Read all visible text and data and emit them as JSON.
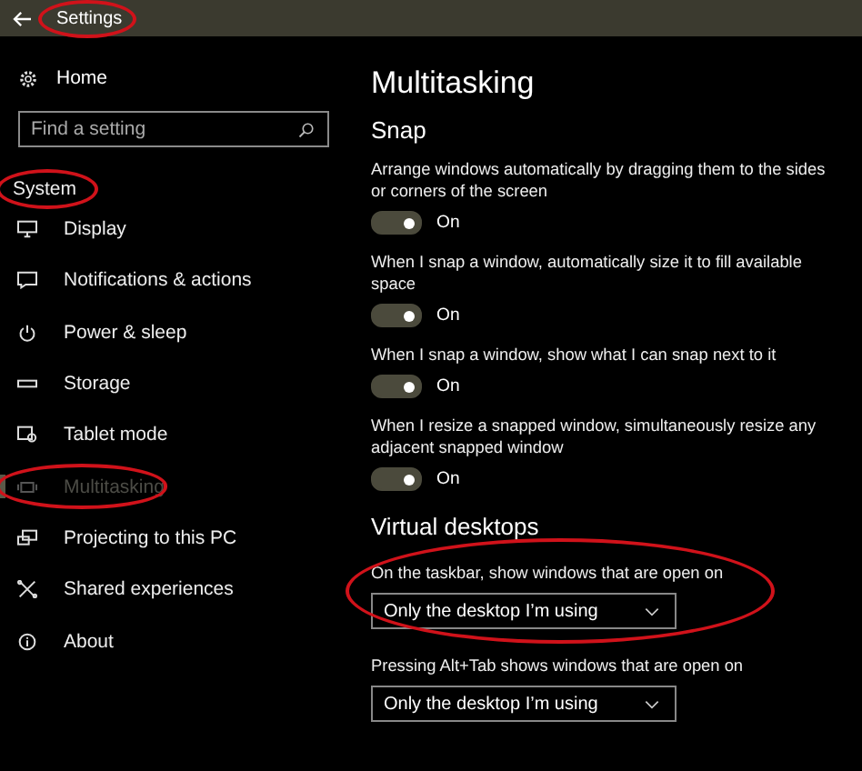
{
  "window": {
    "title": "Settings",
    "title_circled": true
  },
  "sidebar": {
    "home": "Home",
    "search": {
      "placeholder": "Find a setting"
    },
    "section": "System",
    "section_circled": true,
    "items": [
      {
        "label": "Display",
        "selected": false,
        "circled": false
      },
      {
        "label": "Notifications & actions",
        "selected": false,
        "circled": false
      },
      {
        "label": "Power & sleep",
        "selected": false,
        "circled": false
      },
      {
        "label": "Storage",
        "selected": false,
        "circled": false
      },
      {
        "label": "Tablet mode",
        "selected": false,
        "circled": false
      },
      {
        "label": "Multitasking",
        "selected": true,
        "circled": true
      },
      {
        "label": "Projecting to this PC",
        "selected": false,
        "circled": false
      },
      {
        "label": "Shared experiences",
        "selected": false,
        "circled": false
      },
      {
        "label": "About",
        "selected": false,
        "circled": false
      }
    ]
  },
  "page": {
    "title": "Multitasking",
    "snap": {
      "heading": "Snap",
      "settings": [
        {
          "description": "Arrange windows automatically by dragging them to the sides or corners of the screen",
          "on": true,
          "state_label": "On"
        },
        {
          "description": "When I snap a window, automatically size it to fill available space",
          "on": true,
          "state_label": "On"
        },
        {
          "description": "When I snap a window, show what I can snap next to it",
          "on": true,
          "state_label": "On"
        },
        {
          "description": "When I resize a snapped window, simultaneously resize any adjacent snapped window",
          "on": true,
          "state_label": "On"
        }
      ]
    },
    "virtual_desktops": {
      "heading": "Virtual desktops",
      "settings": [
        {
          "label": "On the taskbar, show windows that are open on",
          "value": "Only the desktop I’m using",
          "circled": true
        },
        {
          "label": "Pressing Alt+Tab shows windows that are open on",
          "value": "Only the desktop I’m using",
          "circled": false
        }
      ]
    }
  }
}
